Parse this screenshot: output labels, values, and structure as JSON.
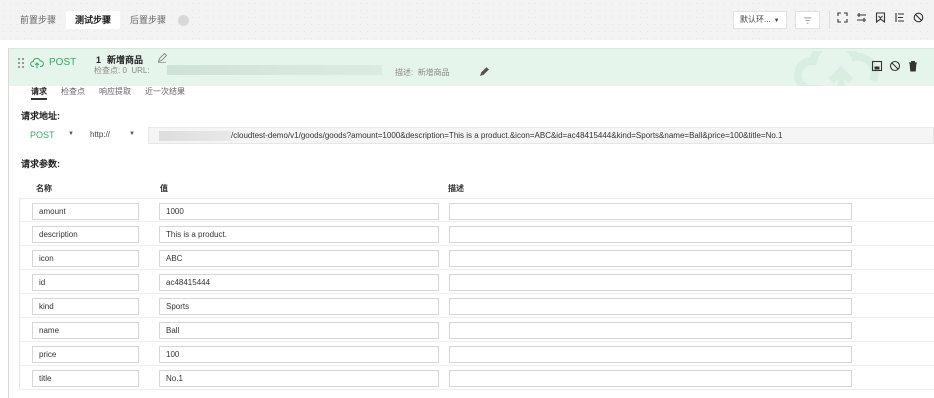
{
  "top_tabs": [
    "前置步骤",
    "测试步骤",
    "后置步骤"
  ],
  "active_top_tab": "测试步骤",
  "environment": {
    "selected": "默认环..."
  },
  "toolbar_icons": [
    "filter-icon",
    "expand-icon",
    "collapse-icon",
    "bookmark-icon",
    "list-icon",
    "disable-icon"
  ],
  "step": {
    "method": "POST",
    "number": "1",
    "title": "新增商品",
    "checkpoints_label": "检查点: 0",
    "url_label": "URL:",
    "description_label": "描述:",
    "description_value": "新增商品"
  },
  "sub_tabs": [
    "请求",
    "检查点",
    "响应提取",
    "近一次结果"
  ],
  "active_sub_tab": "请求",
  "request": {
    "address_label": "请求地址:",
    "method": "POST",
    "protocol": "http://",
    "url_path": "/cloudtest-demo/v1/goods/goods?amount=1000&description=This is a product.&icon=ABC&id=ac48415444&kind=Sports&name=Ball&price=100&title=No.1"
  },
  "params": {
    "label": "请求参数:",
    "columns": [
      "名称",
      "值",
      "描述"
    ],
    "rows": [
      {
        "name": "amount",
        "value": "1000",
        "desc": ""
      },
      {
        "name": "description",
        "value": "This is a product.",
        "desc": ""
      },
      {
        "name": "icon",
        "value": "ABC",
        "desc": ""
      },
      {
        "name": "id",
        "value": "ac48415444",
        "desc": ""
      },
      {
        "name": "kind",
        "value": "Sports",
        "desc": ""
      },
      {
        "name": "name",
        "value": "Ball",
        "desc": ""
      },
      {
        "name": "price",
        "value": "100",
        "desc": ""
      },
      {
        "name": "title",
        "value": "No.1",
        "desc": ""
      }
    ]
  },
  "colors": {
    "accent_green": "#3aa865",
    "header_bg": "#e6f5ec"
  }
}
